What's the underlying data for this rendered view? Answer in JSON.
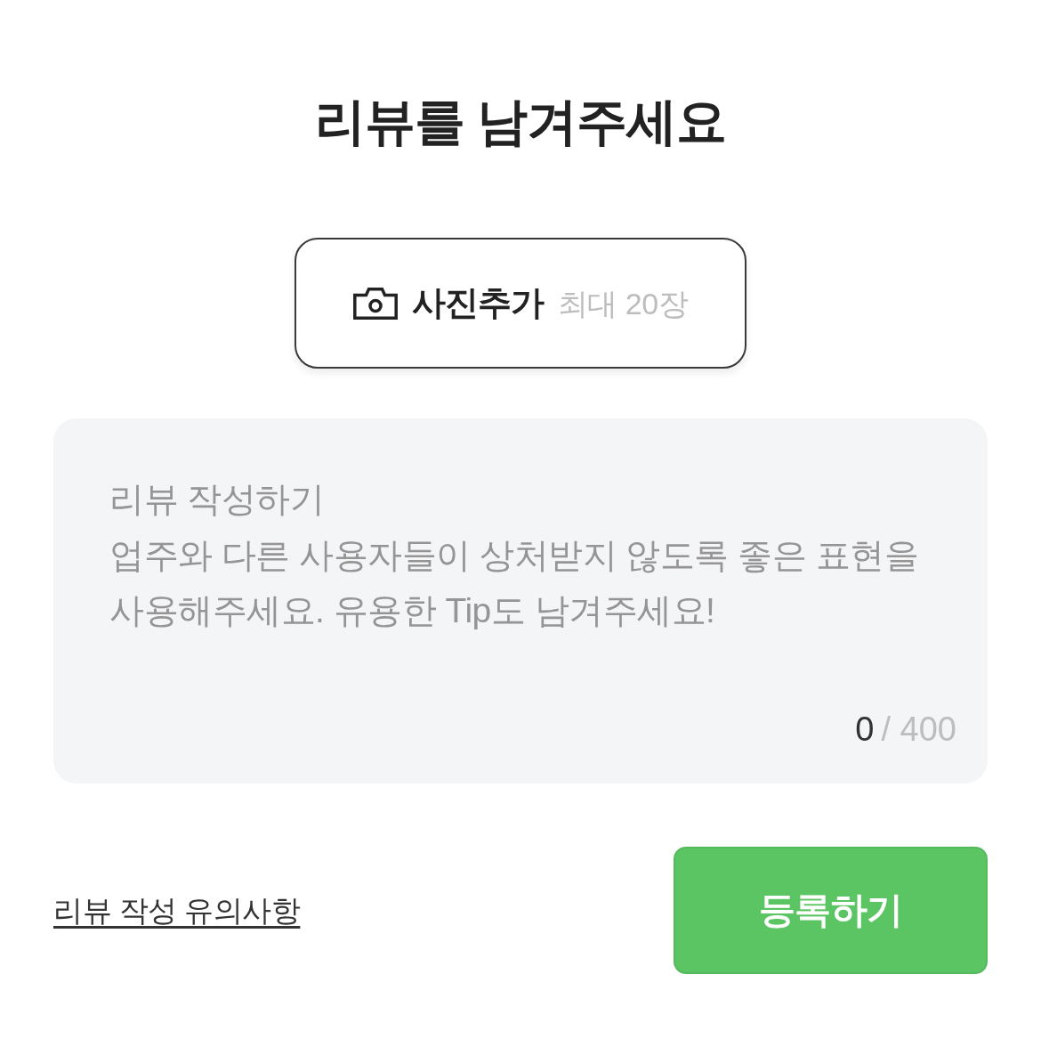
{
  "title": "리뷰를 남겨주세요",
  "photo_button": {
    "label": "사진추가",
    "hint": "최대 20장"
  },
  "review_field": {
    "placeholder": "리뷰 작성하기\n업주와 다른 사용자들이 상처받지 않도록 좋은 표현을\n사용해주세요. 유용한 Tip도 남겨주세요!"
  },
  "counter": {
    "count": "0",
    "max": "/ 400"
  },
  "guide_link": "리뷰 작성 유의사항",
  "submit_button": "등록하기"
}
